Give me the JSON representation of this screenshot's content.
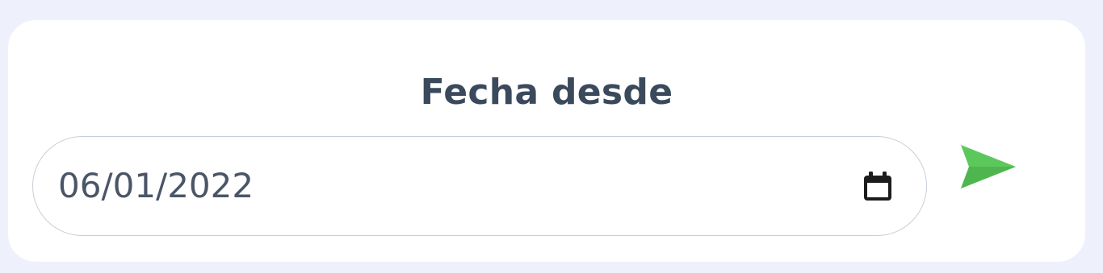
{
  "filter": {
    "title": "Fecha desde",
    "date_value": "06/01/2022"
  },
  "icons": {
    "calendar": "calendar-icon",
    "send": "send-icon"
  },
  "colors": {
    "background": "#eef1fb",
    "card": "#ffffff",
    "title_text": "#3a4a5c",
    "send_accent": "#5cc85c"
  }
}
